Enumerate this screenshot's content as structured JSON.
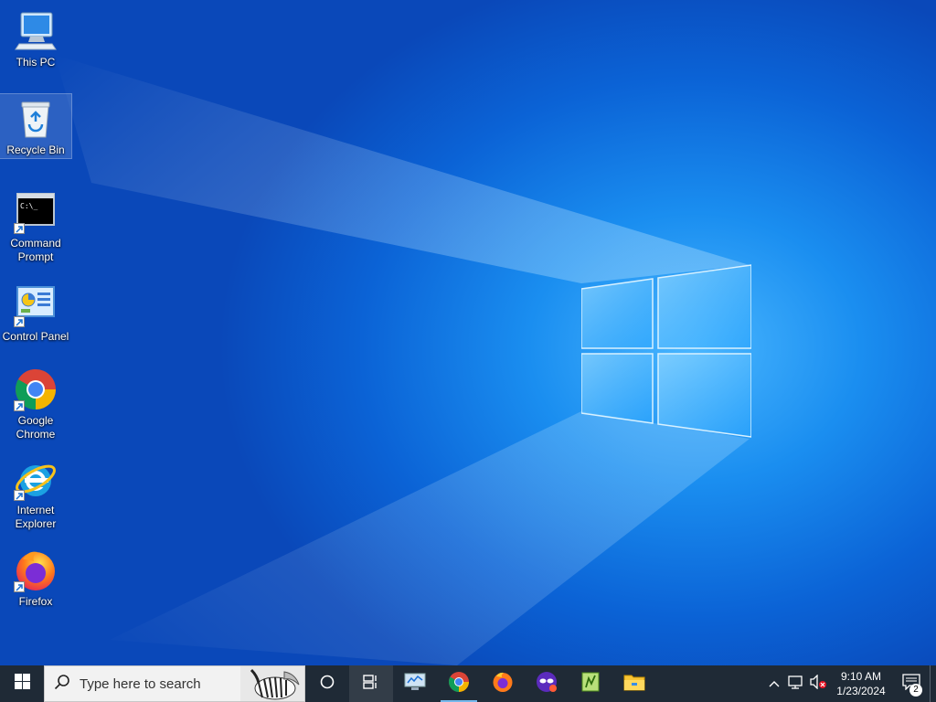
{
  "desktop": {
    "icons": [
      {
        "label": "This PC",
        "icon": "this-pc-icon"
      },
      {
        "label": "Recycle Bin",
        "icon": "recycle-bin-icon"
      },
      {
        "label": "Command\nPrompt",
        "icon": "command-prompt-icon"
      },
      {
        "label": "Control Panel",
        "icon": "control-panel-icon"
      },
      {
        "label": "Google\nChrome",
        "icon": "google-chrome-icon"
      },
      {
        "label": "Internet\nExplorer",
        "icon": "internet-explorer-icon"
      },
      {
        "label": "Firefox",
        "icon": "firefox-icon"
      }
    ]
  },
  "taskbar": {
    "search_placeholder": "Type here to search",
    "pinned": [
      "cortana-icon",
      "task-view-icon",
      "network-monitor-icon",
      "google-chrome-icon",
      "firefox-icon",
      "privacy-mask-icon",
      "notepad-plus-plus-icon",
      "file-explorer-icon"
    ],
    "clock_time": "9:10 AM",
    "clock_date": "1/23/2024",
    "notification_count": "2"
  },
  "colors": {
    "taskbar": "#1f2a36",
    "accent": "#76b9ed",
    "wallpaper_light": "#49b6ff",
    "wallpaper_dark": "#0a48b9"
  }
}
